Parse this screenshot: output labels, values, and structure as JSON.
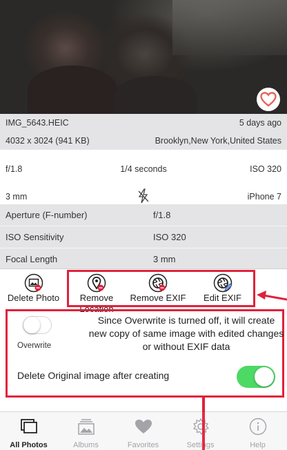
{
  "photo": {
    "filename": "IMG_5643.HEIC",
    "age": "5 days ago",
    "dimensions": "4032 x 3024 (941 KB)",
    "location": "Brooklyn,New York,United States"
  },
  "tech": {
    "aperture": "f/1.8",
    "shutter": "1/4 seconds",
    "iso": "ISO 320",
    "focal": "3 mm",
    "camera": "iPhone 7"
  },
  "exif_rows": [
    {
      "key": "Aperture (F-number)",
      "value": "f/1.8"
    },
    {
      "key": "ISO Sensitivity",
      "value": "ISO 320"
    },
    {
      "key": "Focal Length",
      "value": "3 mm"
    }
  ],
  "actions": {
    "delete_photo": "Delete Photo",
    "remove_location_1": "Remove",
    "remove_location_2": "Location",
    "remove_exif": "Remove EXIF",
    "edit_exif": "Edit EXIF"
  },
  "overwrite": {
    "label": "Overwrite",
    "enabled": false,
    "message": "Since Overwrite is turned off, it will create new copy of same image with edited changes or without EXIF data",
    "delete_original_label": "Delete Original image after creating",
    "delete_original_enabled": true
  },
  "tabs": [
    {
      "label": "All Photos",
      "icon": "all-photos-icon",
      "active": true
    },
    {
      "label": "Albums",
      "icon": "albums-icon",
      "active": false
    },
    {
      "label": "Favorites",
      "icon": "heart-icon",
      "active": false
    },
    {
      "label": "Settings",
      "icon": "gear-icon",
      "active": false
    },
    {
      "label": "Help",
      "icon": "info-icon",
      "active": false
    }
  ],
  "colors": {
    "accent_red": "#e0213a",
    "toggle_on": "#4cd964",
    "heart": "#e8615a"
  }
}
